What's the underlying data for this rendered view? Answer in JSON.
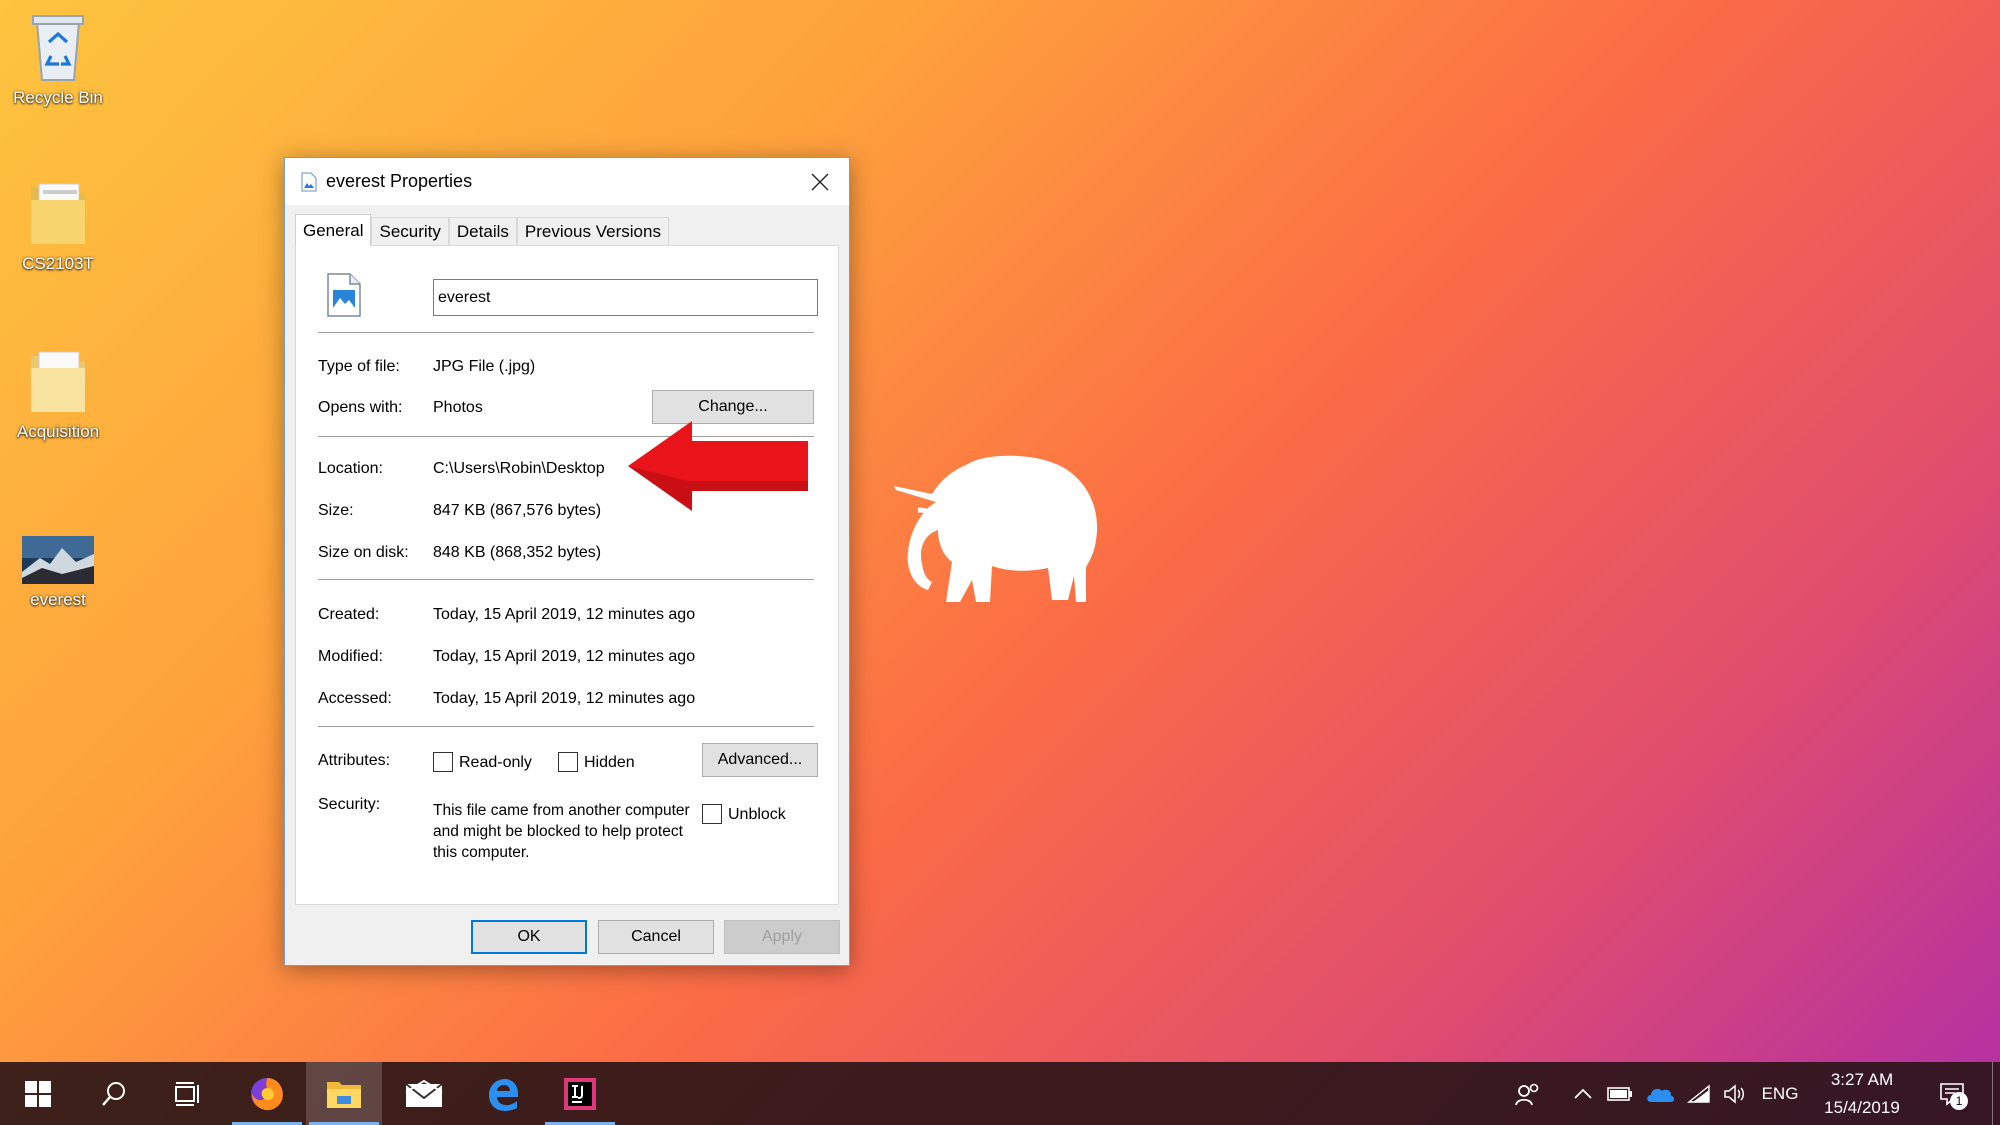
{
  "desktop": {
    "icons": [
      {
        "label": "Recycle Bin",
        "icon": "recycle-bin-icon"
      },
      {
        "label": "CS2103T",
        "icon": "folder-icon"
      },
      {
        "label": "Acquisition",
        "icon": "folder-icon"
      },
      {
        "label": "everest",
        "icon": "image-thumbnail-icon"
      }
    ]
  },
  "dialog": {
    "title": "everest Properties",
    "tabs": [
      "General",
      "Security",
      "Details",
      "Previous Versions"
    ],
    "active_tab": "General",
    "file_name": "everest",
    "type_label": "Type of file:",
    "type_value": "JPG File (.jpg)",
    "opens_label": "Opens with:",
    "opens_value": "Photos",
    "change_button": "Change...",
    "location_label": "Location:",
    "location_value": "C:\\Users\\Robin\\Desktop",
    "size_label": "Size:",
    "size_value": "847 KB (867,576 bytes)",
    "size_disk_label": "Size on disk:",
    "size_disk_value": "848 KB (868,352 bytes)",
    "created_label": "Created:",
    "created_value": "Today, 15 April 2019, 12 minutes ago",
    "modified_label": "Modified:",
    "modified_value": "Today, 15 April 2019, 12 minutes ago",
    "accessed_label": "Accessed:",
    "accessed_value": "Today, 15 April 2019, 12 minutes ago",
    "attributes_label": "Attributes:",
    "readonly_label": "Read-only",
    "hidden_label": "Hidden",
    "advanced_button": "Advanced...",
    "security_label": "Security:",
    "security_text": "This file came from another computer and might be blocked to help protect this computer.",
    "unblock_label": "Unblock",
    "ok_button": "OK",
    "cancel_button": "Cancel",
    "apply_button": "Apply",
    "checkboxes": {
      "read_only": false,
      "hidden": false,
      "unblock": false
    }
  },
  "taskbar": {
    "language": "ENG",
    "time": "3:27 AM",
    "date": "15/4/2019",
    "notification_count": "1"
  },
  "colors": {
    "accent": "#0078d7",
    "arrow": "#e8141a"
  }
}
